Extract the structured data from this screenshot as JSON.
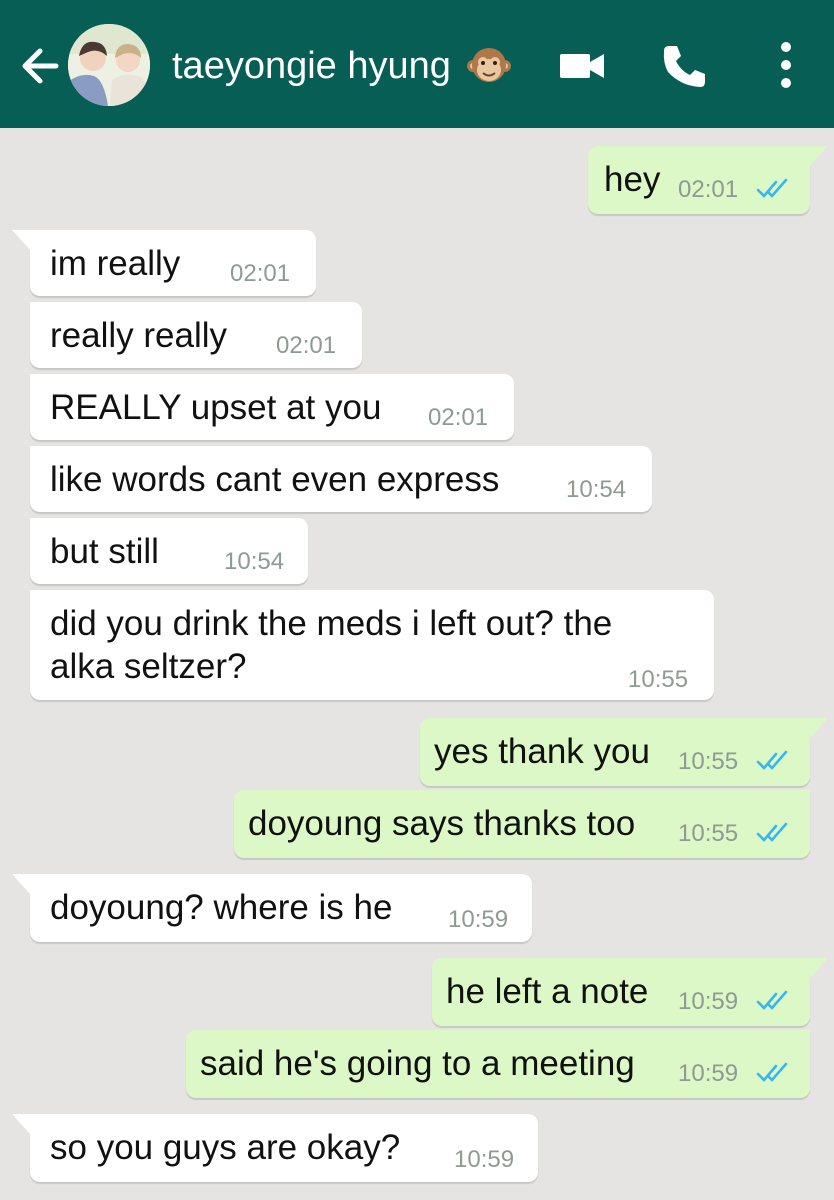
{
  "header": {
    "contact_name": "taeyongie hyung",
    "contact_emoji": "monkey-face",
    "background_color": "#075e54"
  },
  "icons": {
    "back": "arrow-left-icon",
    "video": "video-camera-icon",
    "call": "phone-icon",
    "more": "more-vertical-icon",
    "read": "double-check-blue-icon"
  },
  "colors": {
    "chat_background": "#e5e4e2",
    "incoming_bubble": "#ffffff",
    "outgoing_bubble": "#dcf8c6",
    "read_ticks": "#34b7f1"
  },
  "messages": [
    {
      "direction": "out",
      "text": "hey",
      "time": "02:01",
      "status": "read"
    },
    {
      "direction": "in",
      "text": "im really",
      "time": "02:01"
    },
    {
      "direction": "in",
      "text": "really really",
      "time": "02:01"
    },
    {
      "direction": "in",
      "text": "REALLY upset at you",
      "time": "02:01"
    },
    {
      "direction": "in",
      "text": "like words cant even express",
      "time": "10:54"
    },
    {
      "direction": "in",
      "text": "but still",
      "time": "10:54"
    },
    {
      "direction": "in",
      "text": "did you drink the meds i left out? the alka seltzer?",
      "time": "10:55"
    },
    {
      "direction": "out",
      "text": "yes thank you",
      "time": "10:55",
      "status": "read"
    },
    {
      "direction": "out",
      "text": "doyoung says thanks too",
      "time": "10:55",
      "status": "read"
    },
    {
      "direction": "in",
      "text": "doyoung? where is he",
      "time": "10:59"
    },
    {
      "direction": "out",
      "text": "he left a note",
      "time": "10:59",
      "status": "read"
    },
    {
      "direction": "out",
      "text": "said he's going to a meeting",
      "time": "10:59",
      "status": "read"
    },
    {
      "direction": "in",
      "text": "so you guys are okay?",
      "time": "10:59"
    }
  ]
}
